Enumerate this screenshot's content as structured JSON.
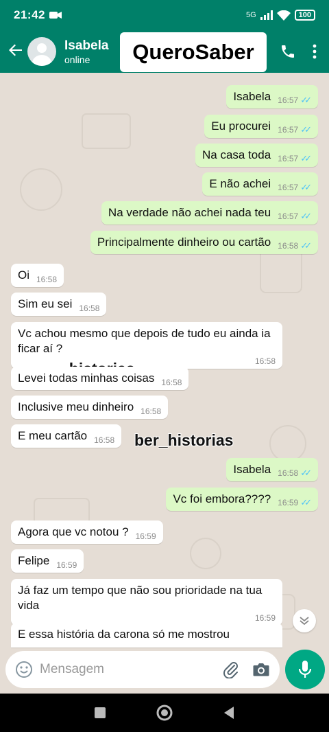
{
  "status_bar": {
    "time": "21:42",
    "network": "5G",
    "battery": "100"
  },
  "header": {
    "contact_name": "Isabela",
    "presence": "online"
  },
  "overlay": {
    "title": "QueroSaber"
  },
  "watermarks": [
    "_historias",
    "ber_historias"
  ],
  "messages": [
    {
      "dir": "out",
      "text": "Isabela",
      "time": "16:57"
    },
    {
      "dir": "out",
      "text": "Eu procurei",
      "time": "16:57"
    },
    {
      "dir": "out",
      "text": "Na casa toda",
      "time": "16:57"
    },
    {
      "dir": "out",
      "text": "E não achei",
      "time": "16:57"
    },
    {
      "dir": "out",
      "text": "Na verdade não achei nada teu",
      "time": "16:57"
    },
    {
      "dir": "out",
      "text": "Principalmente dinheiro ou cartão",
      "time": "16:58"
    },
    {
      "dir": "in",
      "text": "Oi",
      "time": "16:58"
    },
    {
      "dir": "in",
      "text": "Sim eu sei",
      "time": "16:58"
    },
    {
      "dir": "in",
      "text": "Vc achou mesmo que depois de tudo eu ainda ia ficar aí ?",
      "time": "16:58"
    },
    {
      "dir": "in",
      "text": "Levei todas minhas coisas",
      "time": "16:58"
    },
    {
      "dir": "in",
      "text": "Inclusive meu dinheiro",
      "time": "16:58"
    },
    {
      "dir": "in",
      "text": "E meu cartão",
      "time": "16:58"
    },
    {
      "dir": "out",
      "text": "Isabela",
      "time": "16:58"
    },
    {
      "dir": "out",
      "text": "Vc foi embora????",
      "time": "16:59"
    },
    {
      "dir": "in",
      "text": "Agora que vc notou ?",
      "time": "16:59"
    },
    {
      "dir": "in",
      "text": "Felipe",
      "time": "16:59"
    },
    {
      "dir": "in",
      "text": "Já faz um tempo que não sou prioridade na tua vida",
      "time": "16:59"
    },
    {
      "dir": "in",
      "text": "E essa história da carona só me mostrou",
      "time": ""
    }
  ],
  "composer": {
    "placeholder": "Mensagem"
  },
  "colors": {
    "header": "#008069",
    "outgoing_bubble": "#dcf8c6",
    "incoming_bubble": "#ffffff",
    "mic_button": "#00a884",
    "read_ticks": "#4fc3f7"
  },
  "icons": [
    "back-arrow-icon",
    "phone-icon",
    "more-vert-icon",
    "emoji-icon",
    "attach-icon",
    "camera-icon",
    "mic-icon",
    "chevron-down-icon",
    "nav-recents-icon",
    "nav-home-icon",
    "nav-back-icon"
  ]
}
